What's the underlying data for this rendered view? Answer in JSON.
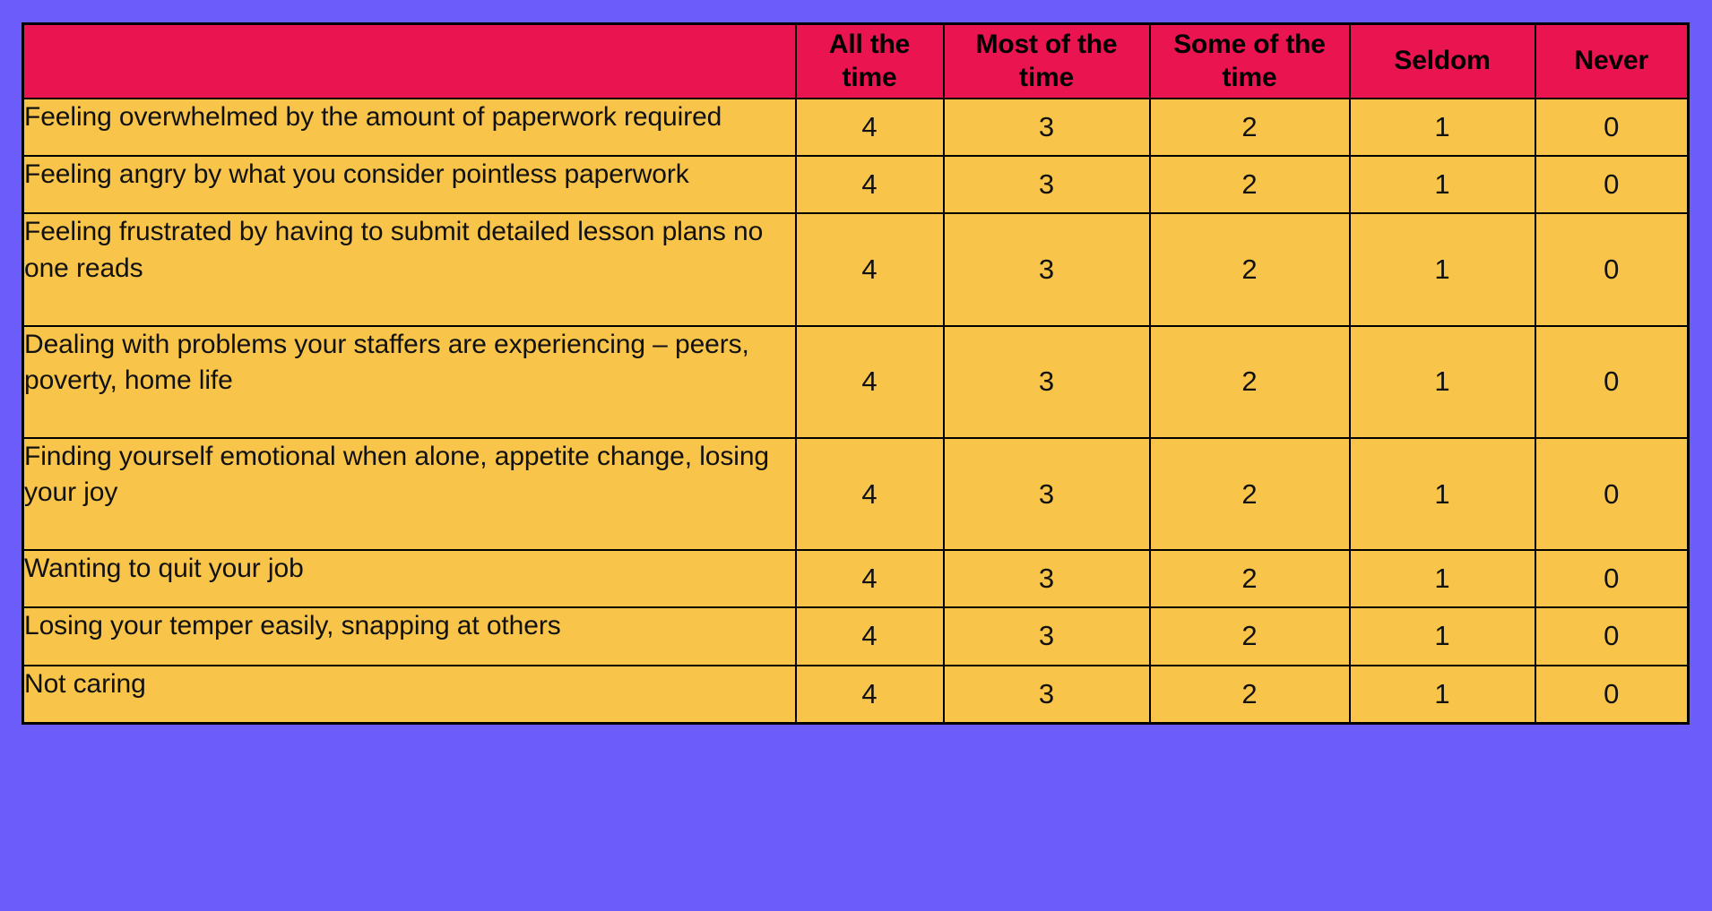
{
  "colors": {
    "background": "#6c5cfa",
    "table_fill": "#f8c44a",
    "header_fill": "#ea1450",
    "border": "#000000",
    "text": "#111111"
  },
  "table": {
    "headers": {
      "statement_column": "",
      "scale": [
        "All the time",
        "Most of the time",
        "Some of the time",
        "Seldom",
        "Never"
      ]
    },
    "scale_values": [
      "4",
      "3",
      "2",
      "1",
      "0"
    ],
    "rows": [
      {
        "statement": "Feeling overwhelmed by the amount of paperwork required",
        "scores": [
          "4",
          "3",
          "2",
          "1",
          "0"
        ]
      },
      {
        "statement": "Feeling angry by what you consider pointless paperwork",
        "scores": [
          "4",
          "3",
          "2",
          "1",
          "0"
        ]
      },
      {
        "statement": "Feeling frustrated by having to submit detailed lesson plans no one reads",
        "scores": [
          "4",
          "3",
          "2",
          "1",
          "0"
        ]
      },
      {
        "statement": "Dealing with problems your staffers are experiencing – peers, poverty, home life",
        "scores": [
          "4",
          "3",
          "2",
          "1",
          "0"
        ]
      },
      {
        "statement": "Finding yourself emotional when alone, appetite change, losing your joy",
        "scores": [
          "4",
          "3",
          "2",
          "1",
          "0"
        ]
      },
      {
        "statement": "Wanting to quit your job",
        "scores": [
          "4",
          "3",
          "2",
          "1",
          "0"
        ]
      },
      {
        "statement": "Losing your temper easily, snapping at others",
        "scores": [
          "4",
          "3",
          "2",
          "1",
          "0"
        ]
      },
      {
        "statement": "Not caring",
        "scores": [
          "4",
          "3",
          "2",
          "1",
          "0"
        ]
      }
    ]
  }
}
